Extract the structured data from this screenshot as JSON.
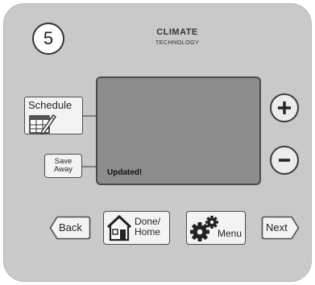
{
  "step": "5",
  "brand": {
    "line1": "CLIMATE",
    "line2": "TECHNOLOGY"
  },
  "screen": {
    "status": "Updated!"
  },
  "buttons": {
    "schedule": "Schedule",
    "save_line1": "Save",
    "save_line2": "Away",
    "back": "Back",
    "done_line1": "Done/",
    "done_line2": "Home",
    "menu": "Menu",
    "next": "Next"
  },
  "colors": {
    "panel": "#c9c9c9",
    "screen": "#8d8d8d",
    "button_face": "#f3f3f3",
    "outline": "#3b3b3b"
  },
  "icons": {
    "schedule": "calendar-pencil-icon",
    "plus": "plus-icon",
    "minus": "minus-icon",
    "done": "house-icon",
    "menu": "gears-icon"
  }
}
